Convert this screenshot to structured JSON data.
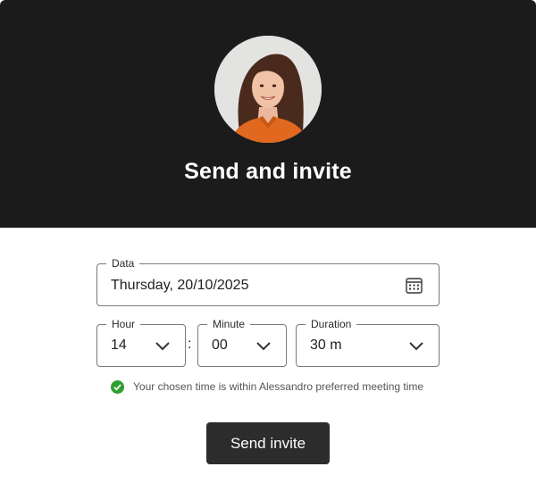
{
  "header": {
    "title": "Send and invite",
    "avatar_icon": "person-avatar"
  },
  "form": {
    "date": {
      "label": "Data",
      "value": "Thursday, 20/10/2025",
      "icon": "calendar-icon"
    },
    "hour": {
      "label": "Hour",
      "value": "14"
    },
    "separator": ":",
    "minute": {
      "label": "Minute",
      "value": "00"
    },
    "duration": {
      "label": "Duration",
      "value": "30 m"
    },
    "hint": {
      "text": "Your chosen time is within Alessandro preferred meeting time",
      "icon": "check-circle-icon"
    }
  },
  "actions": {
    "send_label": "Send invite"
  },
  "colors": {
    "header_bg": "#1b1b1b",
    "button_bg": "#2c2c2c",
    "success": "#2e9e2e"
  }
}
